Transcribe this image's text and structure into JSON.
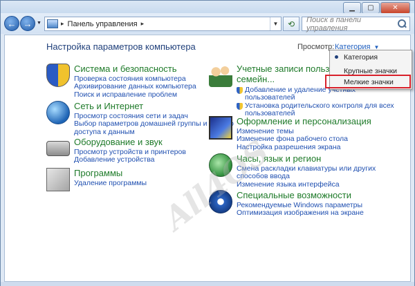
{
  "address_bar": {
    "path": "Панель управления",
    "separator": "▸"
  },
  "search": {
    "placeholder": "Поиск в панели управления"
  },
  "page": {
    "title": "Настройка параметров компьютера",
    "view_label": "Просмотр:",
    "view_value": "Категория"
  },
  "view_menu": {
    "items": [
      "Категория",
      "Крупные значки",
      "Мелкие значки"
    ],
    "selected": "Категория",
    "highlighted": "Мелкие значки"
  },
  "categories_left": [
    {
      "title": "Система и безопасность",
      "icon": "security-shield-icon",
      "links": [
        "Проверка состояния компьютера",
        "Архивирование данных компьютера",
        "Поиск и исправление проблем"
      ]
    },
    {
      "title": "Сеть и Интернет",
      "icon": "network-globe-icon",
      "links": [
        "Просмотр состояния сети и задач",
        "Выбор параметров домашней группы и общего",
        "доступа к данным"
      ]
    },
    {
      "title": "Оборудование и звук",
      "icon": "printer-icon",
      "links": [
        "Просмотр устройств и принтеров",
        "Добавление устройства"
      ]
    },
    {
      "title": "Программы",
      "icon": "programs-icon",
      "links": [
        "Удаление программы"
      ]
    }
  ],
  "categories_right": [
    {
      "title_line1": "Учетные записи пользовате",
      "title_line2": "семейн...",
      "icon": "users-icon",
      "links": [
        "Добавление и удаление учетных",
        "пользователей",
        "Установка родительского контроля для всех",
        "пользователей"
      ]
    },
    {
      "title": "Оформление и персонализация",
      "icon": "display-icon",
      "links": [
        "Изменение темы",
        "Изменение фона рабочего стола",
        "Настройка разрешения экрана"
      ]
    },
    {
      "title": "Часы, язык и регион",
      "icon": "clock-globe-icon",
      "links": [
        "Смена раскладки клавиатуры или других",
        "способов ввода",
        "Изменение языка интерфейса"
      ]
    },
    {
      "title": "Специальные возможности",
      "icon": "accessibility-icon",
      "links": [
        "Рекомендуемые Windows параметры",
        "Оптимизация изображения на экране"
      ]
    }
  ],
  "watermark": "All4OS"
}
